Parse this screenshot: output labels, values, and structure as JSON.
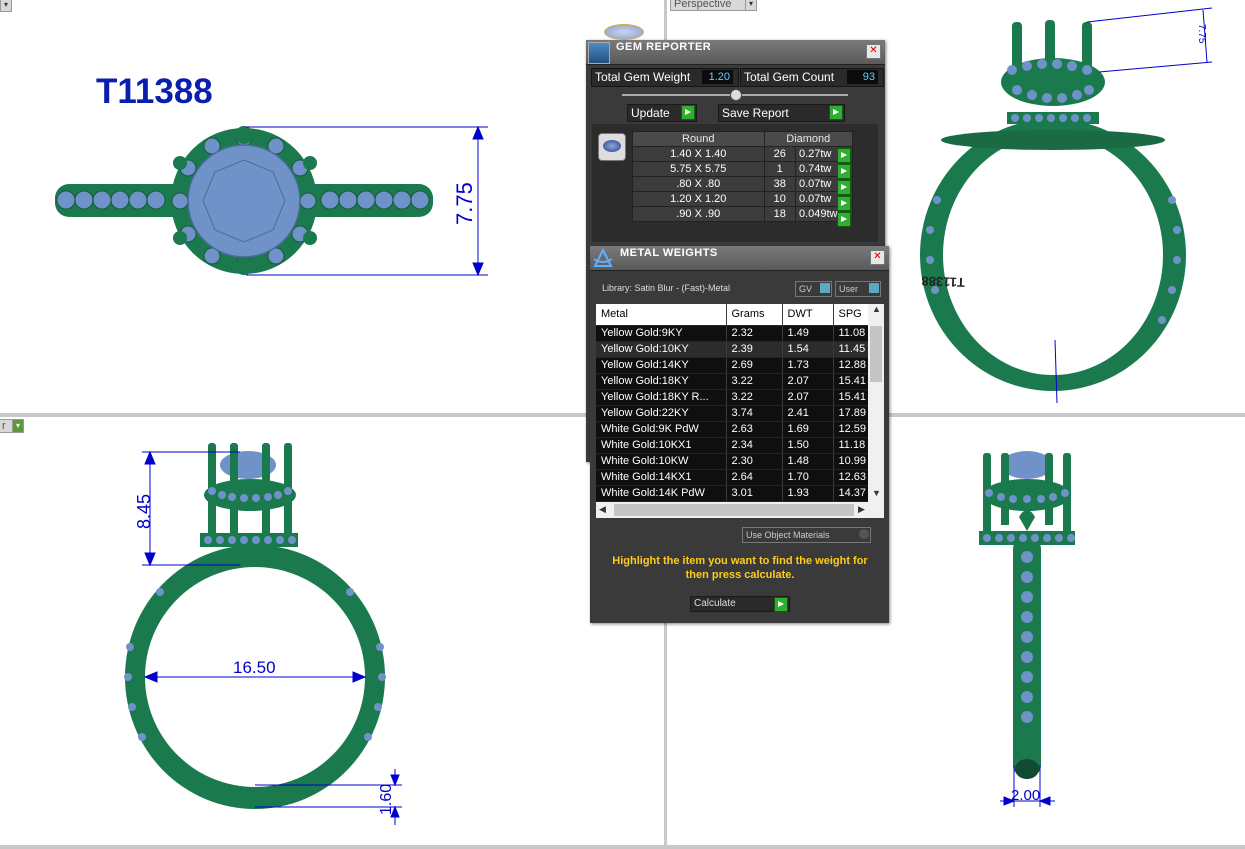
{
  "viewports": {
    "top_left": {
      "label": "",
      "ring_id": "T11388",
      "dim_height": "7.75"
    },
    "top_right": {
      "label": "Perspective",
      "dim_top": "7.75",
      "engraving": "T11388"
    },
    "bottom_left": {
      "label": "r",
      "dim_height": "8.45",
      "dim_inner": "16.50",
      "dim_shank": "1.60"
    },
    "bottom_right": {
      "label": "",
      "dim_width": "2.00"
    }
  },
  "gem_reporter": {
    "title": "GEM REPORTER",
    "total_gem_weight_label": "Total Gem Weight",
    "total_gem_weight_value": "1.20",
    "total_gem_count_label": "Total Gem Count",
    "total_gem_count_value": "93",
    "update_label": "Update",
    "save_report_label": "Save Report",
    "table_header": {
      "shape": "Round",
      "material": "Diamond"
    },
    "rows": [
      {
        "size": "1.40 X 1.40",
        "count": "26",
        "weight": "0.27tw"
      },
      {
        "size": "5.75 X 5.75",
        "count": "1",
        "weight": "0.74tw"
      },
      {
        "size": ".80 X .80",
        "count": "38",
        "weight": "0.07tw"
      },
      {
        "size": "1.20 X 1.20",
        "count": "10",
        "weight": "0.07tw"
      },
      {
        "size": ".90 X .90",
        "count": "18",
        "weight": "0.049tw"
      }
    ]
  },
  "metal_weights": {
    "title": "METAL WEIGHTS",
    "library_label": "Library: Satin Blur - (Fast)-Metal",
    "gv_label": "GV",
    "user_label": "User",
    "headers": {
      "metal": "Metal",
      "grams": "Grams",
      "dwt": "DWT",
      "spg": "SPG"
    },
    "rows": [
      {
        "metal": "Yellow Gold:9KY",
        "grams": "2.32",
        "dwt": "1.49",
        "spg": "11.08"
      },
      {
        "metal": "Yellow Gold:10KY",
        "grams": "2.39",
        "dwt": "1.54",
        "spg": "11.45"
      },
      {
        "metal": "Yellow Gold:14KY",
        "grams": "2.69",
        "dwt": "1.73",
        "spg": "12.88"
      },
      {
        "metal": "Yellow Gold:18KY",
        "grams": "3.22",
        "dwt": "2.07",
        "spg": "15.41"
      },
      {
        "metal": "Yellow Gold:18KY R...",
        "grams": "3.22",
        "dwt": "2.07",
        "spg": "15.41"
      },
      {
        "metal": "Yellow Gold:22KY",
        "grams": "3.74",
        "dwt": "2.41",
        "spg": "17.89"
      },
      {
        "metal": "White Gold:9K PdW",
        "grams": "2.63",
        "dwt": "1.69",
        "spg": "12.59"
      },
      {
        "metal": "White Gold:10KX1",
        "grams": "2.34",
        "dwt": "1.50",
        "spg": "11.18"
      },
      {
        "metal": "White Gold:10KW",
        "grams": "2.30",
        "dwt": "1.48",
        "spg": "10.99"
      },
      {
        "metal": "White Gold:14KX1",
        "grams": "2.64",
        "dwt": "1.70",
        "spg": "12.63"
      },
      {
        "metal": "White Gold:14K PdW",
        "grams": "3.01",
        "dwt": "1.93",
        "spg": "14.37"
      }
    ],
    "use_object_materials_label": "Use Object Materials",
    "hint": "Highlight the item you want to find the weight for then press calculate.",
    "calculate_label": "Calculate"
  },
  "colors": {
    "metal": "#1a7a4e",
    "gem": "#6f93c8",
    "dimension": "#0000cc",
    "title": "#0a1fb0",
    "hint": "#ffcc1a"
  }
}
